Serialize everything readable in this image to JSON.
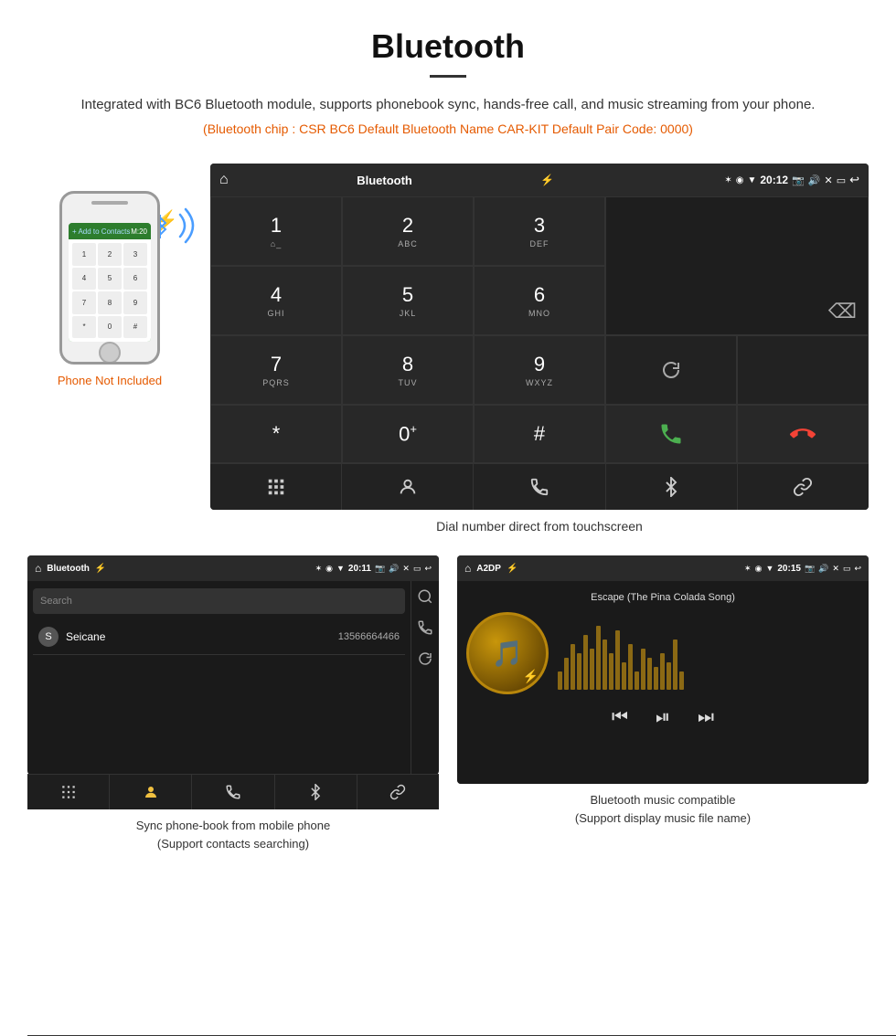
{
  "header": {
    "title": "Bluetooth",
    "description": "Integrated with BC6 Bluetooth module, supports phonebook sync, hands-free call, and music streaming from your phone.",
    "specs": "(Bluetooth chip : CSR BC6   Default Bluetooth Name CAR-KIT    Default Pair Code: 0000)"
  },
  "phone": {
    "not_included_label": "Phone Not Included"
  },
  "dialpad_screen": {
    "status_bar": {
      "home": "⌂",
      "title": "Bluetooth",
      "usb_icon": "⚡",
      "time": "20:12",
      "icons": "✶ ◉ ▼ 📷 🔊 ✕ ▭ ↩"
    },
    "keys": [
      {
        "main": "1",
        "sub": "⌂_"
      },
      {
        "main": "2",
        "sub": "ABC"
      },
      {
        "main": "3",
        "sub": "DEF"
      },
      {
        "main": "4",
        "sub": "GHI"
      },
      {
        "main": "5",
        "sub": "JKL"
      },
      {
        "main": "6",
        "sub": "MNO"
      },
      {
        "main": "7",
        "sub": "PQRS"
      },
      {
        "main": "8",
        "sub": "TUV"
      },
      {
        "main": "9",
        "sub": "WXYZ"
      },
      {
        "main": "*",
        "sub": ""
      },
      {
        "main": "0⁺",
        "sub": ""
      },
      {
        "main": "#",
        "sub": ""
      }
    ],
    "caption": "Dial number direct from touchscreen",
    "bottom_nav": [
      "⊞",
      "👤",
      "📞",
      "✶",
      "🔗"
    ]
  },
  "contacts_screen": {
    "status_bar": {
      "home": "⌂",
      "title": "Bluetooth",
      "usb_icon": "⚡",
      "time": "20:11"
    },
    "search_placeholder": "Search",
    "contacts": [
      {
        "letter": "S",
        "name": "Seicane",
        "number": "13566664466"
      }
    ],
    "caption_line1": "Sync phone-book from mobile phone",
    "caption_line2": "(Support contacts searching)"
  },
  "music_screen": {
    "status_bar": {
      "home": "⌂",
      "title": "A2DP",
      "usb_icon": "⚡",
      "time": "20:15"
    },
    "song_title": "Escape (The Pina Colada Song)",
    "caption_line1": "Bluetooth music compatible",
    "caption_line2": "(Support display music file name)"
  },
  "colors": {
    "accent_orange": "#e55a00",
    "screen_bg": "#1a1a1a",
    "key_bg": "#282828",
    "call_green": "#4caf50",
    "call_red": "#f44336"
  }
}
